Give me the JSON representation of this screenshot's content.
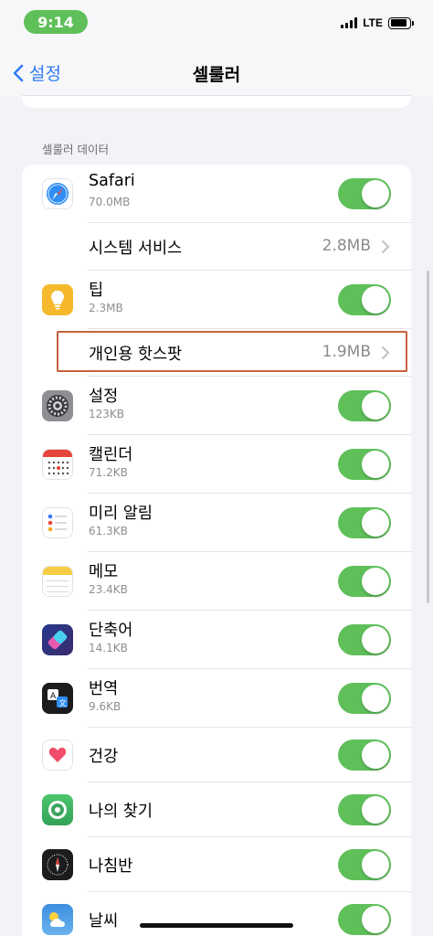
{
  "status_bar": {
    "time": "9:14",
    "network": "LTE",
    "battery_level": 0.85
  },
  "nav": {
    "back_label": "설정",
    "title": "셀룰러"
  },
  "section": {
    "header": "셀룰러 데이터"
  },
  "rows": [
    {
      "type": "app",
      "icon": "safari-icon",
      "title": "Safari",
      "subtitle": "70.0MB",
      "toggle_on": true
    },
    {
      "type": "link",
      "title": "시스템 서비스",
      "value": "2.8MB"
    },
    {
      "type": "app",
      "icon": "tips-icon",
      "title": "팁",
      "subtitle": "2.3MB",
      "toggle_on": true
    },
    {
      "type": "link",
      "title": "개인용 핫스팟",
      "value": "1.9MB",
      "highlighted": true
    },
    {
      "type": "app",
      "icon": "settings-icon",
      "title": "설정",
      "subtitle": "123KB",
      "toggle_on": true
    },
    {
      "type": "app",
      "icon": "calendar-icon",
      "title": "캘린더",
      "subtitle": "71.2KB",
      "toggle_on": true
    },
    {
      "type": "app",
      "icon": "reminders-icon",
      "title": "미리 알림",
      "subtitle": "61.3KB",
      "toggle_on": true
    },
    {
      "type": "app",
      "icon": "notes-icon",
      "title": "메모",
      "subtitle": "23.4KB",
      "toggle_on": true
    },
    {
      "type": "app",
      "icon": "shortcuts-icon",
      "title": "단축어",
      "subtitle": "14.1KB",
      "toggle_on": true
    },
    {
      "type": "app",
      "icon": "translate-icon",
      "title": "번역",
      "subtitle": "9.6KB",
      "toggle_on": true
    },
    {
      "type": "app",
      "icon": "health-icon",
      "title": "건강",
      "toggle_on": true
    },
    {
      "type": "app",
      "icon": "find-my-icon",
      "title": "나의 찾기",
      "toggle_on": true
    },
    {
      "type": "app",
      "icon": "compass-icon",
      "title": "나침반",
      "toggle_on": true
    },
    {
      "type": "app",
      "icon": "weather-icon",
      "title": "날씨",
      "toggle_on": true
    }
  ],
  "colors": {
    "accent": "#2f7cf6",
    "toggle_on": "#5fc05a",
    "highlight": "#c8623c"
  }
}
